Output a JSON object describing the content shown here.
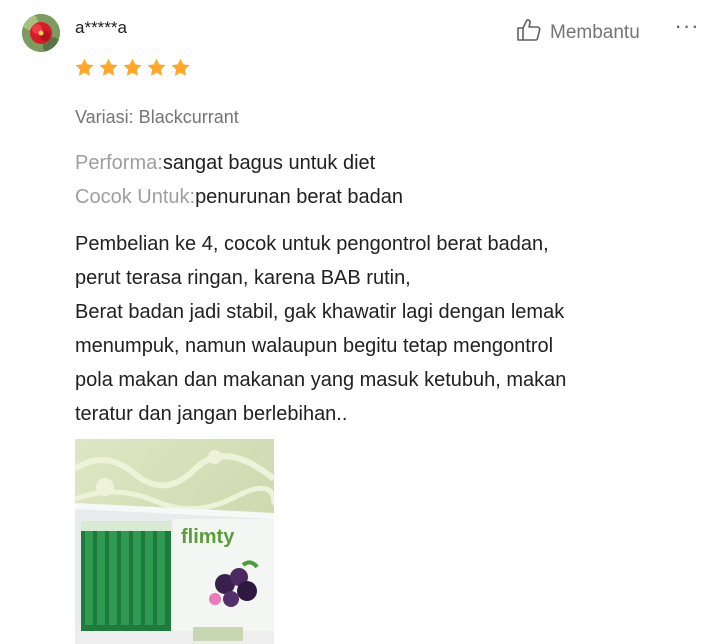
{
  "review": {
    "username": "a*****a",
    "rating": 5,
    "variation": "Variasi: Blackcurrant",
    "attributes": [
      {
        "key": "Performa:",
        "value": "sangat bagus untuk diet"
      },
      {
        "key": "Cocok Untuk:",
        "value": "penurunan berat badan"
      }
    ],
    "text_lines": [
      "Pembelian ke 4, cocok untuk pengontrol berat badan,",
      "perut terasa ringan, karena BAB rutin,",
      "Berat badan jadi stabil, gak khawatir lagi dengan lemak",
      "menumpuk, namun walaupun begitu tetap mengontrol",
      "pola makan dan makanan yang masuk ketubuh, makan",
      "teratur dan jangan berlebihan.."
    ],
    "photo_brand_text": "flimty"
  },
  "actions": {
    "helpful_label": "Membantu",
    "more_label": "···"
  },
  "icons": {
    "avatar": "flower-avatar",
    "helpful": "thumbs-up-icon",
    "more": "more-dots-icon",
    "star": "star-icon"
  },
  "colors": {
    "star": "#ffa726",
    "muted_text": "#757575",
    "label_text": "#9e9e9e",
    "body_text": "#212121"
  }
}
